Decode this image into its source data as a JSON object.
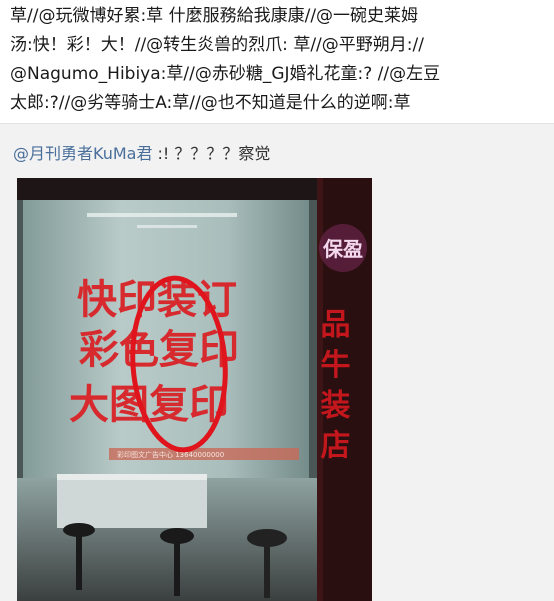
{
  "post": {
    "lines": [
      "草//@玩微博好累:草 什麼服務給我康康//@一碗史莱姆",
      "汤:快！彩！大！//@转生炎兽的烈爪: 草//@平野朔月://",
      "@Nagumo_Hibiya:草//@赤砂糖_GJ婚礼花童:? //@左豆",
      "太郎:?//@劣等骑士A:草//@也不知道是什么的逆啊:草"
    ]
  },
  "repost": {
    "user": "@月刊勇者KuMa君",
    "text": " :! ？？？？察觉"
  },
  "photo": {
    "sign_lines": [
      "快印装订",
      "彩色复印",
      "大图复印"
    ],
    "right_banner_text": "品 牛 装 店",
    "brand_text": "保盈",
    "phone_text": "彩印图文广告中心 13640000000",
    "colors": {
      "sign_red": "#d72a2e",
      "circle_red": "#e0141c",
      "glass": "#9fb6b4"
    }
  }
}
